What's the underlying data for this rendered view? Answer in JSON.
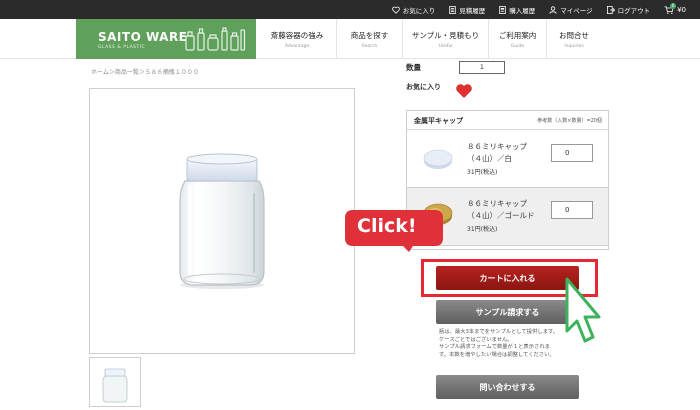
{
  "topbar": {
    "items": [
      {
        "label": "お気に入り",
        "icon": "heart-outline-icon"
      },
      {
        "label": "見積履歴",
        "icon": "document-icon"
      },
      {
        "label": "購入履歴",
        "icon": "receipt-icon"
      },
      {
        "label": "マイページ",
        "icon": "user-icon"
      },
      {
        "label": "ログアウト",
        "icon": "logout-icon"
      }
    ],
    "cart_badge": "0",
    "cart_total": "¥0"
  },
  "logo": {
    "title": "SAITO WARE",
    "subtitle": "GLASS & PLASTIC",
    "color": "#5fa05a"
  },
  "nav": [
    {
      "jp": "斎藤容器の強み",
      "en": "Advantage"
    },
    {
      "jp": "商品を探す",
      "en": "Search"
    },
    {
      "jp": "サンプル・見積もり",
      "en": "Useful"
    },
    {
      "jp": "ご利用案内",
      "en": "Guide"
    },
    {
      "jp": "お問合せ",
      "en": "Inquiries"
    }
  ],
  "breadcrumb": "ホーム＞商品一覧＞５８６摘瓶１０００",
  "product": {
    "qty_label": "数量",
    "qty_value": "1",
    "favorite_label": "お気に入り"
  },
  "cap_section": {
    "title": "金属平キャップ",
    "note": "参考数（入数×数量）=20個",
    "items": [
      {
        "name_line1": "８６ミリキャップ",
        "name_line2": "（４山）／白",
        "price": "31円(税込)",
        "qty": "0",
        "cap_color": "#dfe6f2"
      },
      {
        "name_line1": "８６ミリキャップ",
        "name_line2": "（４山）／ゴールド",
        "price": "31円(税込)",
        "qty": "0",
        "cap_color": "#c9a43f"
      }
    ]
  },
  "callout": {
    "text": "Click!",
    "color": "#e0303a"
  },
  "buttons": {
    "cart": "カートに入れる",
    "sample": "サンプル請求する",
    "inquiry": "問い合わせする"
  },
  "sample_note": [
    "瓶は、最大3本までをサンプルとして提供します。",
    "ケースごとではございません。",
    "サンプル請求フォームで数量が１と表示されま",
    "す。本数を増やしたい場合は調整してください。"
  ],
  "colors": {
    "accent_red": "#e62833",
    "cart_button": "#a51d1a",
    "gray_button": "#707070",
    "cursor_green": "#3cb25a"
  }
}
